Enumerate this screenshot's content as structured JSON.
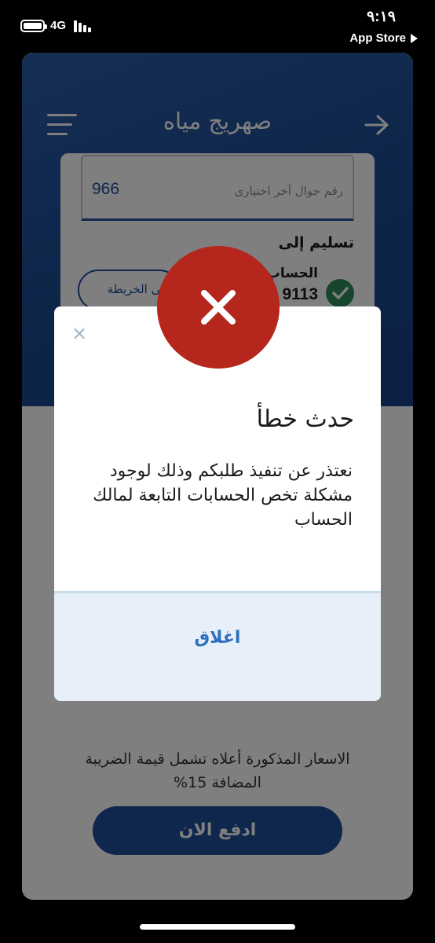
{
  "status_bar": {
    "network": "4G",
    "time": "٩:١٩",
    "back_app": "App Store"
  },
  "app": {
    "title": "صهريج مياه",
    "phone_field": {
      "value": "966",
      "placeholder": "رقم جوال آخر اختيارى"
    },
    "deliver_to_label": "تسليم إلى",
    "map_button_label": "على الخريطة",
    "account_label": "الحساب",
    "account_number": "9113",
    "vat_note": "الاسعار المذكورة أعلاه تشمل قيمة الضريبة المضافة 15%",
    "pay_button_label": "ادفع الان"
  },
  "dialog": {
    "close_icon": "×",
    "title": "حدث خطأ",
    "message": "نعتذر عن تنفيذ طلبكم وذلك لوجود مشكلة تخص الحسابات التابعة لمالك الحساب",
    "close_button_label": "اغلاق"
  },
  "icons": {
    "menu": "menu-icon",
    "forward": "arrow-right-icon",
    "check": "check-icon",
    "error": "x-icon",
    "battery": "battery-icon",
    "signal": "signal-icon"
  },
  "colors": {
    "header_blue": "#1c4a94",
    "primary_blue": "#1f4f9a",
    "error_red": "#b5261d",
    "success_green": "#2f8a5c",
    "link_blue": "#2d6fbe",
    "dialog_footer": "#e7eff8"
  }
}
